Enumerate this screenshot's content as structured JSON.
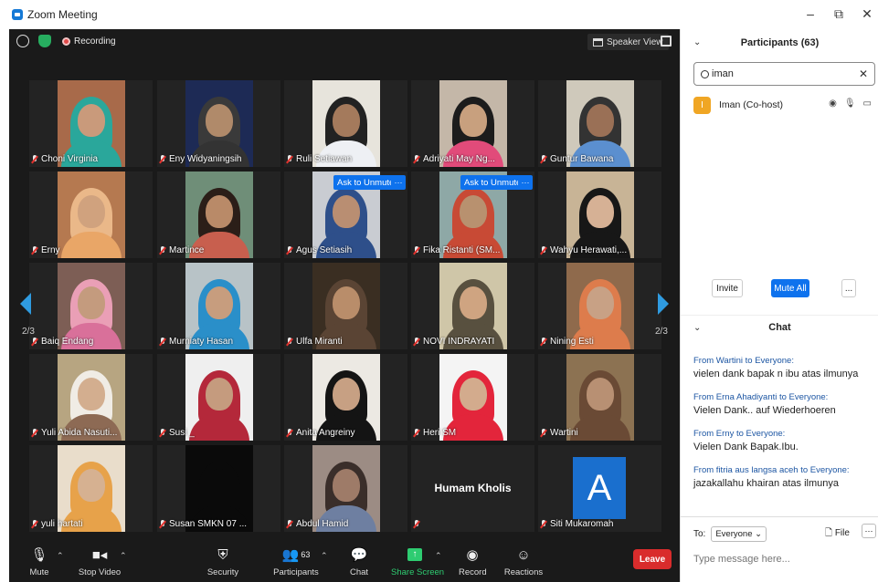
{
  "window": {
    "title": "Zoom Meeting",
    "minimize": "–",
    "restore": "⧉",
    "close": "✕"
  },
  "topbar": {
    "recording": "Recording",
    "view": "Speaker View"
  },
  "tiles": [
    {
      "name": "Choni Virginia",
      "bg": "#a86a4a",
      "skin": "#c99a7b",
      "hood": "#2aa79b",
      "body": "#2aa79b"
    },
    {
      "name": "Eny Widyaningsih",
      "bg": "#1d2a55",
      "skin": "#b08a6a",
      "hood": "#3a3a3a",
      "body": "#333"
    },
    {
      "name": "Ruli Setiawan",
      "bg": "#e7e4dc",
      "skin": "#a47a5c",
      "hood": "#222",
      "body": "#eef0f4"
    },
    {
      "name": "Adriyati May Ng...",
      "bg": "#c4b7a8",
      "skin": "#c8a07e",
      "hood": "#1c1c1c",
      "body": "#e14b7a"
    },
    {
      "name": "Guntur Bawana",
      "bg": "#cfc9bb",
      "skin": "#9a7056",
      "hood": "#333",
      "body": "#5b8fcf"
    },
    {
      "name": "Erny",
      "bg": "#b57950",
      "skin": "#d0a27e",
      "hood": "#eab889",
      "body": "#e9a667"
    },
    {
      "name": "Martince",
      "bg": "#6f8e78",
      "skin": "#b98a68",
      "hood": "#2b1e18",
      "body": "#c85f4e"
    },
    {
      "name": "Agus Setiasih",
      "bg": "#c9ccd2",
      "skin": "#b98e72",
      "hood": "#2e4f8a",
      "body": "#2e4f8a",
      "unmute": "Ask to Unmute"
    },
    {
      "name": "Fika Ristanti (SM...",
      "bg": "#8ea8a6",
      "skin": "#b8916f",
      "hood": "#c84a35",
      "body": "#c84a35",
      "unmute": "Ask to Unmute"
    },
    {
      "name": "Wahyu Herawati,...",
      "bg": "#c8b496",
      "skin": "#d6b195",
      "hood": "#171717",
      "body": "#171717"
    },
    {
      "name": "Baiq Endang",
      "bg": "#7d5e55",
      "skin": "#c49b7e",
      "hood": "#ea9fb6",
      "body": "#d9709a"
    },
    {
      "name": "Murniaty Hasan",
      "bg": "#b8c3c7",
      "skin": "#c79d7e",
      "hood": "#2a8fc9",
      "body": "#2a8fc9"
    },
    {
      "name": "Ulfa Miranti",
      "bg": "#3a2e22",
      "skin": "#b98d6a",
      "hood": "#5a4434",
      "body": "#5a4434"
    },
    {
      "name": "NOVI INDRAYATI",
      "bg": "#cfc6a8",
      "skin": "#cfa481",
      "hood": "#58503f",
      "body": "#58503f"
    },
    {
      "name": "Nining Esti",
      "bg": "#8f6a4c",
      "skin": "#c8a185",
      "hood": "#dd7c4c",
      "body": "#dd7c4c"
    },
    {
      "name": "Yuli Abida Nasuti...",
      "bg": "#b7a581",
      "skin": "#d3ae8f",
      "hood": "#f0ece5",
      "body": "#8d6a54"
    },
    {
      "name": "Susi _",
      "bg": "#efefef",
      "skin": "#c59b7e",
      "hood": "#b4283a",
      "body": "#b4283a"
    },
    {
      "name": "Anita Angreiny",
      "bg": "#ece9e3",
      "skin": "#c7a083",
      "hood": "#141414",
      "body": "#141414"
    },
    {
      "name": "Heri SM",
      "bg": "#f4f4f4",
      "skin": "#d3ab8d",
      "hood": "#e3253b",
      "body": "#e3253b"
    },
    {
      "name": "Wartini",
      "bg": "#8c7252",
      "skin": "#b89073",
      "hood": "#6a4a35",
      "body": "#6a4a35"
    },
    {
      "name": "yuli hartati",
      "bg": "#e9ddcb",
      "skin": "#d6b191",
      "hood": "#e7a24a",
      "body": "#e7a24a"
    },
    {
      "name": "Susan SMKN 07 ...",
      "bg": "#0a0a0a",
      "skin": "#0a0a0a",
      "hood": "#0a0a0a",
      "body": "#0a0a0a"
    },
    {
      "name": "Abdul Hamid",
      "bg": "#9c8c84",
      "skin": "#9e7b68",
      "hood": "#3a2e2a",
      "body": "#6e7fa1"
    },
    {
      "name": "",
      "label": "Humam Kholis"
    },
    {
      "name": "Siti Mukaromah",
      "avatar": "A"
    }
  ],
  "page": {
    "left": "2/3",
    "right": "2/3"
  },
  "toolbar": {
    "mute": "Mute",
    "video": "Stop Video",
    "security": "Security",
    "participants": "Participants",
    "participants_count": "63",
    "chat": "Chat",
    "share": "Share Screen",
    "record": "Record",
    "reactions": "Reactions",
    "leave": "Leave"
  },
  "participants_panel": {
    "title": "Participants (63)",
    "search_value": "iman",
    "result_initial": "I",
    "result_name": "Iman (Co-host)",
    "invite": "Invite",
    "mute_all": "Mute All",
    "more": "..."
  },
  "chat": {
    "title": "Chat",
    "messages": [
      {
        "from": "From Wartini to Everyone:",
        "text": "vielen dank bapak n ibu atas ilmunya"
      },
      {
        "from": "From Erna Ahadiyanti to Everyone:",
        "text": "Vielen Dank.. auf Wiederhoeren"
      },
      {
        "from": "From Erny to Everyone:",
        "text": "Vielen Dank Bapak.Ibu."
      },
      {
        "from": "From fitria aus langsa aceh to Everyone:",
        "text": "jazakallahu khairan atas ilmunya"
      }
    ],
    "to_label": "To:",
    "to_value": "Everyone ⌄",
    "file": "File",
    "placeholder": "Type message here..."
  },
  "colors": {
    "accent": "#0e72ed",
    "leave": "#d92c2c",
    "share": "#2ecc71",
    "avatar_a": "#1a6fce",
    "host": "#f0a624"
  }
}
